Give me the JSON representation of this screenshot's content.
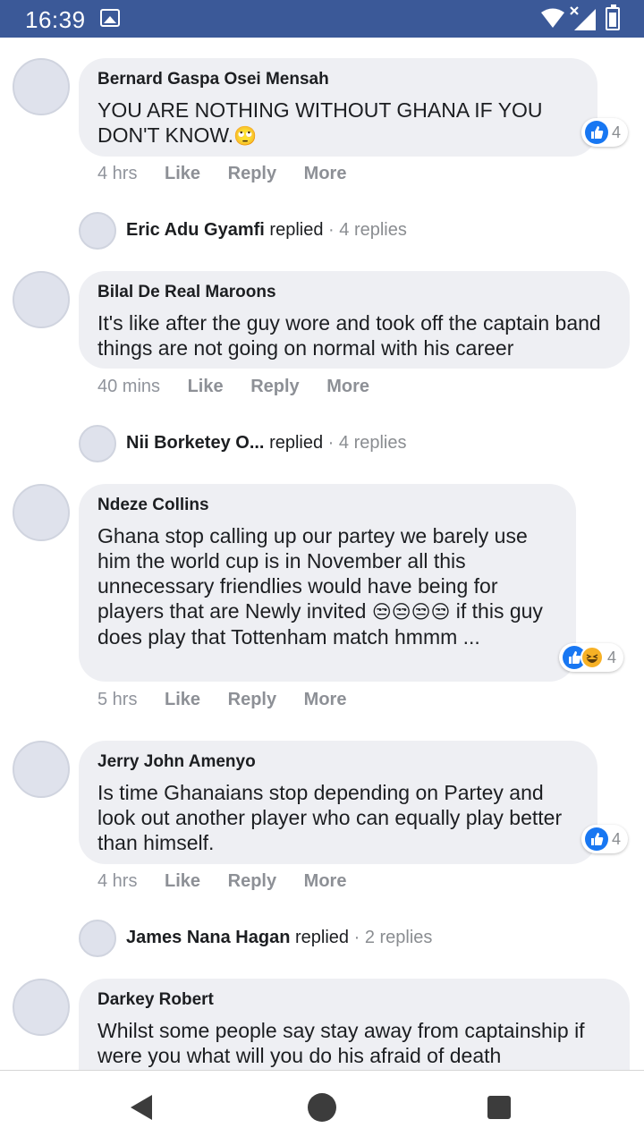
{
  "status_bar": {
    "time": "16:39",
    "icons": [
      "gallery-icon",
      "wifi-icon",
      "signal-icon",
      "battery-icon"
    ]
  },
  "comments": [
    {
      "author": "Bernard Gaspa Osei Mensah",
      "text": "YOU ARE NOTHING WITHOUT GHANA IF YOU DON'T KNOW.",
      "emoji": "🙄",
      "time": "4 hrs",
      "actions": [
        "Like",
        "Reply",
        "More"
      ],
      "reactions": {
        "types": [
          "like"
        ],
        "count": "4"
      },
      "replies": {
        "author": "Eric Adu Gyamfi",
        "verb": "replied",
        "sep": "·",
        "count": "4 replies"
      }
    },
    {
      "author": "Bilal De Real Maroons",
      "text": "It's like after the guy wore and took off the captain band things are not going on normal with his career",
      "time": "40 mins",
      "actions": [
        "Like",
        "Reply",
        "More"
      ],
      "replies": {
        "author": "Nii Borketey O...",
        "verb": "replied",
        "sep": "·",
        "count": "4 replies"
      }
    },
    {
      "author": "Ndeze Collins",
      "text_before": "Ghana stop calling up our partey we barely use him the world cup is in November all this unnecessary friendlies would have being for players that are Newly invited",
      "emoji": "😒😒😒😒",
      "text_after": "if this guy does play that Tottenham match hmmm ...",
      "time": "5 hrs",
      "actions": [
        "Like",
        "Reply",
        "More"
      ],
      "reactions": {
        "types": [
          "like",
          "haha"
        ],
        "count": "4"
      }
    },
    {
      "author": "Jerry John Amenyo",
      "text": "Is time Ghanaians stop depending on Partey and look out another player who can equally play better than himself.",
      "time": "4 hrs",
      "actions": [
        "Like",
        "Reply",
        "More"
      ],
      "reactions": {
        "types": [
          "like"
        ],
        "count": "4"
      },
      "replies": {
        "author": "James Nana Hagan",
        "verb": "replied",
        "sep": "·",
        "count": "2 replies"
      }
    },
    {
      "author": "Darkey Robert",
      "text": "Whilst some people say stay away from captainship if were you what will you do his afraid of death"
    }
  ],
  "nav_bar": {
    "icons": [
      "back-icon",
      "home-icon",
      "recents-icon"
    ]
  },
  "colors": {
    "status_bar": "#3b5998",
    "bubble": "#eeeff3",
    "like_blue": "#1877f2",
    "haha_yellow": "#f7b125",
    "meta_gray": "#8a8d91"
  }
}
